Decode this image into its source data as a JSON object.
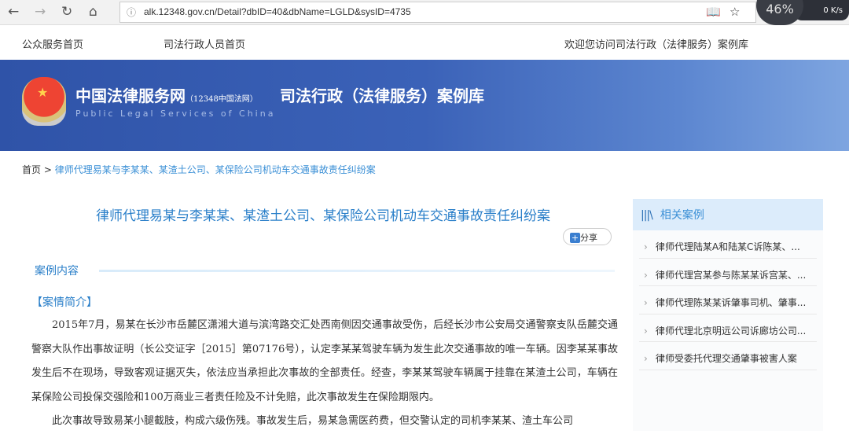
{
  "browser": {
    "url": "alk.12348.gov.cn/Detail?dbID=40&dbName=LGLD&sysID=4735",
    "gauge": "46%",
    "net": "0 K/s"
  },
  "topnav": {
    "public_home": "公众服务首页",
    "staff_home": "司法行政人员首页",
    "welcome": "欢迎您访问司法行政（法律服务）案例库"
  },
  "banner": {
    "site_name": "中国法律服务网",
    "site_sub": "（12348中国法网）",
    "english": "Public Legal Services of China",
    "library": "司法行政（法律服务）案例库"
  },
  "breadcrumb": {
    "home": "首页",
    "sep": ">",
    "current": "律师代理易某与李某某、某渣土公司、某保险公司机动车交通事故责任纠纷案"
  },
  "article": {
    "title": "律师代理易某与李某某、某渣土公司、某保险公司机动车交通事故责任纠纷案",
    "share": "分享",
    "section": "案例内容",
    "subheading": "【案情简介】",
    "paragraphs": [
      "2015年7月，易某在长沙市岳麓区潇湘大道与滨湾路交汇处西南侧因交通事故受伤，后经长沙市公安局交通警察支队岳麓交通警察大队作出事故证明（长公交证字［2015］第07176号），认定李某某驾驶车辆为发生此次交通事故的唯一车辆。因李某某事故发生后不在现场，导致客观证据灭失，依法应当承担此次事故的全部责任。经查，李某某驾驶车辆属于挂靠在某渣土公司，车辆在某保险公司投保交强险和100万商业三者责任险及不计免赔，此次事故发生在保险期限内。",
      "此次事故导致易某小腿截肢，构成六级伤残。事故发生后，易某急需医药费，但交警认定的司机李某某、渣土车公司"
    ]
  },
  "sidebar": {
    "title": "相关案例",
    "items": [
      "律师代理陆某A和陆某C诉陈某、...",
      "律师代理宫某参与陈某某诉宫某、...",
      "律师代理陈某某诉肇事司机、肇事...",
      "律师代理北京明远公司诉廊坊公司...",
      "律师受委托代理交通肇事被害人案"
    ]
  }
}
